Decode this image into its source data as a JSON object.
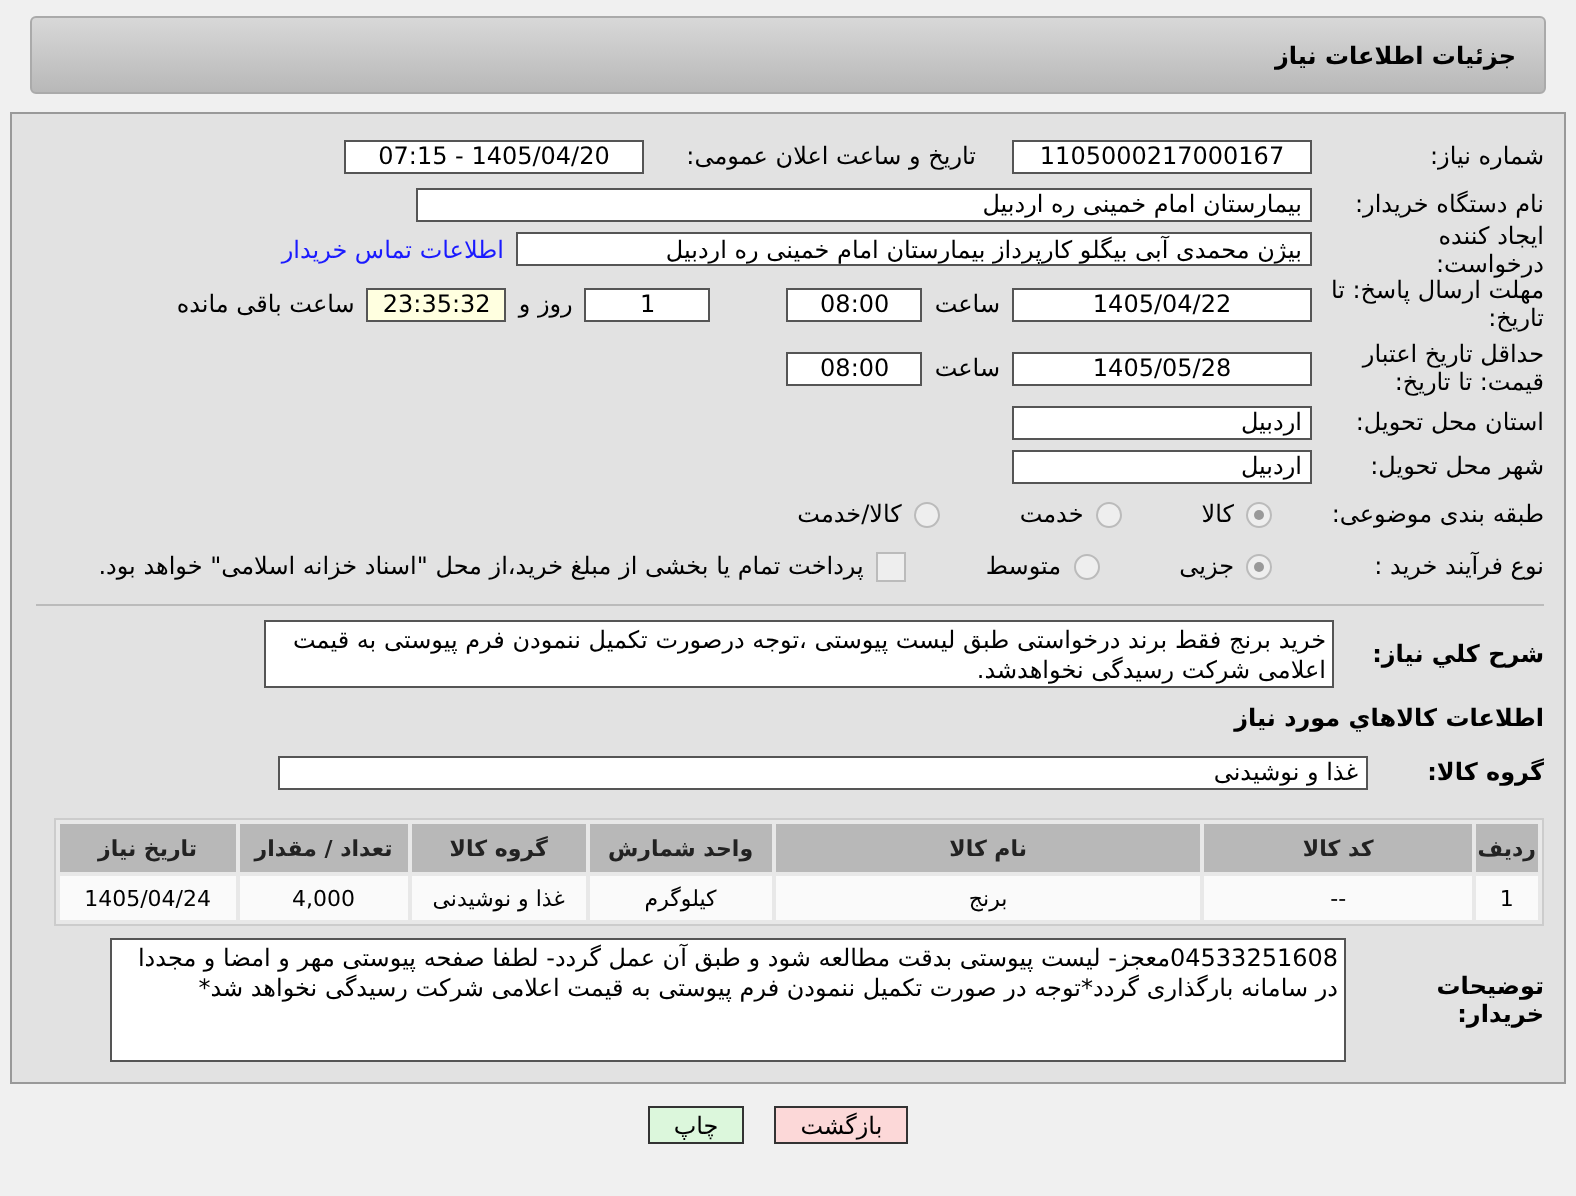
{
  "header": {
    "title": "جزئیات اطلاعات نیاز"
  },
  "need_number": {
    "label": "شماره نیاز:",
    "value": "1105000217000167"
  },
  "announce": {
    "label": "تاریخ و ساعت اعلان عمومی:",
    "value": "1405/04/20 - 07:15"
  },
  "buyer_org": {
    "label": "نام دستگاه خریدار:",
    "value": "بیمارستان امام خمینی  ره  اردبیل"
  },
  "creator": {
    "label": "ایجاد کننده درخواست:",
    "value": "بیژن محمدی آبی بیگلو کارپرداز بیمارستان امام خمینی  ره  اردبیل",
    "link": "اطلاعات تماس خریدار"
  },
  "deadline": {
    "label": "مهلت ارسال پاسخ: تا تاریخ:",
    "date": "1405/04/22",
    "time_label": "ساعت",
    "time": "08:00",
    "days": "1",
    "days_label": "روز و",
    "remaining": "23:35:32",
    "remaining_label": "ساعت باقی مانده"
  },
  "validity": {
    "label": "حداقل تاریخ اعتبار قیمت: تا تاریخ:",
    "date": "1405/05/28",
    "time_label": "ساعت",
    "time": "08:00"
  },
  "province": {
    "label": "استان محل تحویل:",
    "value": "اردبیل"
  },
  "city": {
    "label": "شهر محل تحویل:",
    "value": "اردبیل"
  },
  "category": {
    "label": "طبقه بندی موضوعی:",
    "options": [
      {
        "label": "کالا",
        "selected": true
      },
      {
        "label": "خدمت",
        "selected": false
      },
      {
        "label": "کالا/خدمت",
        "selected": false
      }
    ]
  },
  "process": {
    "label": "نوع فرآیند خرید :",
    "options": [
      {
        "label": "جزیی",
        "selected": true
      },
      {
        "label": "متوسط",
        "selected": false
      }
    ],
    "payment": {
      "checked": false,
      "label": "پرداخت تمام یا بخشی از مبلغ خرید،از محل \"اسناد خزانه اسلامی\" خواهد بود."
    }
  },
  "description": {
    "label": "شرح کلي نياز:",
    "value": "خرید برنج فقط برند درخواستی  طبق لیست پیوستی ،توجه درصورت تکمیل ننمودن فرم پیوستی به قیمت اعلامی شرکت رسیدگی نخواهدشد."
  },
  "goods_heading": "اطلاعات کالاهاي مورد نياز",
  "goods_group": {
    "label": "گروه کالا:",
    "value": "غذا و نوشیدنی"
  },
  "table": {
    "columns": [
      "ردیف",
      "کد کالا",
      "نام کالا",
      "واحد شمارش",
      "گروه کالا",
      "تعداد / مقدار",
      "تاریخ نیاز"
    ],
    "rows": [
      [
        "1",
        "--",
        "برنج",
        "کیلوگرم",
        "غذا و نوشیدنی",
        "4,000",
        "1405/04/24"
      ]
    ]
  },
  "buyer_notes": {
    "label": "توضیحات خریدار:",
    "value": "04533251608معجز- لیست پیوستی بدقت مطالعه شود و طبق آن عمل گردد- لطفا صفحه پیوستی مهر و امضا و مجددا در سامانه بارگذاری گردد*توجه در صورت تکمیل ننمودن فرم پیوستی به قیمت اعلامی شرکت رسیدگی نخواهد شد*"
  },
  "buttons": [
    {
      "label": "بازگشت",
      "kind": "back"
    },
    {
      "label": "چاپ",
      "kind": "print"
    }
  ]
}
